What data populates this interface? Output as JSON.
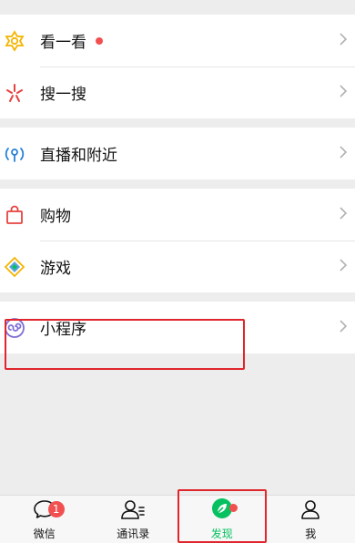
{
  "menu": {
    "kanyikan": {
      "label": "看一看",
      "icon": "flower-star-icon",
      "has_dot": true
    },
    "souyisou": {
      "label": "搜一搜",
      "icon": "search-sparkle-icon"
    },
    "zhibo": {
      "label": "直播和附近",
      "icon": "live-location-icon"
    },
    "gouwu": {
      "label": "购物",
      "icon": "shopping-bag-icon"
    },
    "youxi": {
      "label": "游戏",
      "icon": "game-diamond-icon"
    },
    "xiaochengxu": {
      "label": "小程序",
      "icon": "mini-program-icon"
    }
  },
  "tabbar": {
    "weixin": {
      "label": "微信",
      "badge": "1"
    },
    "tongxunlu": {
      "label": "通讯录"
    },
    "faxian": {
      "label": "发现",
      "active": true
    },
    "wo": {
      "label": "我"
    }
  },
  "colors": {
    "accent": "#07c160",
    "badge": "#f25050",
    "highlight": "#e0262d"
  }
}
